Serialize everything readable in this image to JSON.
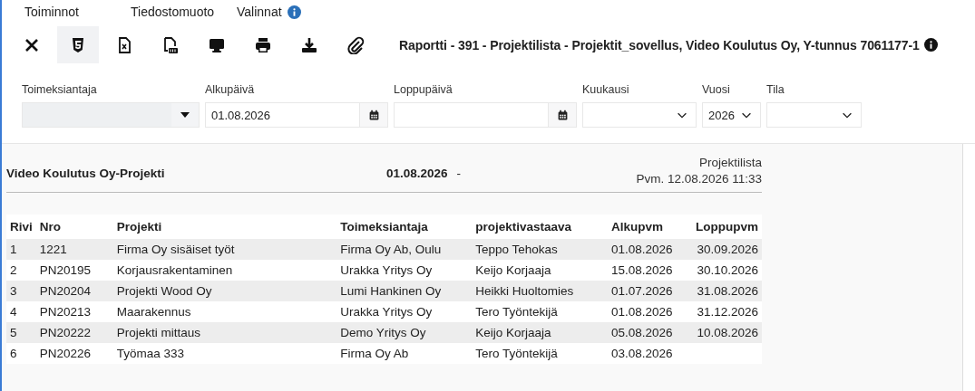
{
  "menu": [
    {
      "label": "Toiminnot",
      "info": false
    },
    {
      "label": "Tiedostomuoto",
      "info": false
    },
    {
      "label": "Valinnat",
      "info": true
    }
  ],
  "toolbar": [
    {
      "kind": "close",
      "selected": false
    },
    {
      "kind": "html",
      "selected": true
    },
    {
      "kind": "excel",
      "selected": false
    },
    {
      "kind": "pdf",
      "selected": false
    },
    {
      "kind": "screen",
      "selected": false
    },
    {
      "kind": "print",
      "selected": false
    },
    {
      "kind": "download",
      "selected": false
    },
    {
      "kind": "attach",
      "selected": false
    }
  ],
  "report_title": "Raportti - 391 - Projektilista - Projektit_sovellus, Video Koulutus Oy, Y-tunnus 7061177-1",
  "filters": [
    {
      "kind": "combo",
      "label": "Toimeksiantaja",
      "disabled": true
    },
    {
      "kind": "date",
      "label": "Alkupäivä",
      "value": "01.08.2026"
    },
    {
      "kind": "date",
      "label": "Loppupäivä"
    },
    {
      "kind": "select",
      "label": "Kuukausi"
    },
    {
      "kind": "select",
      "label": "Vuosi",
      "value": "2026"
    },
    {
      "kind": "select",
      "label": "Tila"
    }
  ],
  "report": {
    "company": "Video Koulutus Oy-Projekti",
    "start_date": "01.08.2026",
    "separator": "-",
    "name": "Projektilista",
    "printed": "Pvm. 12.08.2026 11:33"
  },
  "table": {
    "columns": [
      "Rivi",
      "Nro",
      "Projekti",
      "Toimeksiantaja",
      "projektivastaava",
      "Alkupvm",
      "Loppupvm"
    ],
    "rows": [
      [
        "1",
        "1221",
        "Firma Oy sisäiset työt",
        "Firma Oy Ab, Oulu",
        "Teppo Tehokas",
        "01.08.2026",
        "30.09.2026"
      ],
      [
        "2",
        "PN20195",
        "Korjausrakentaminen",
        "Urakka Yritys Oy",
        "Keijo Korjaaja",
        "15.08.2026",
        "30.10.2026"
      ],
      [
        "3",
        "PN20204",
        "Projekti Wood Oy",
        "Lumi Hankinen Oy",
        "Heikki Huoltomies",
        "01.07.2026",
        "31.08.2026"
      ],
      [
        "4",
        "PN20213",
        "Maarakennus",
        "Urakka Yritys Oy",
        "Tero Työntekijä",
        "01.08.2026",
        "31.12.2026"
      ],
      [
        "5",
        "PN20222",
        "Projekti mittaus",
        "Demo Yritys Oy",
        "Keijo Korjaaja",
        "05.08.2026",
        "10.08.2026"
      ],
      [
        "6",
        "PN20226",
        "Työmaa 333",
        "Firma Oy Ab",
        "Tero Työntekijä",
        "03.08.2026",
        ""
      ]
    ]
  }
}
